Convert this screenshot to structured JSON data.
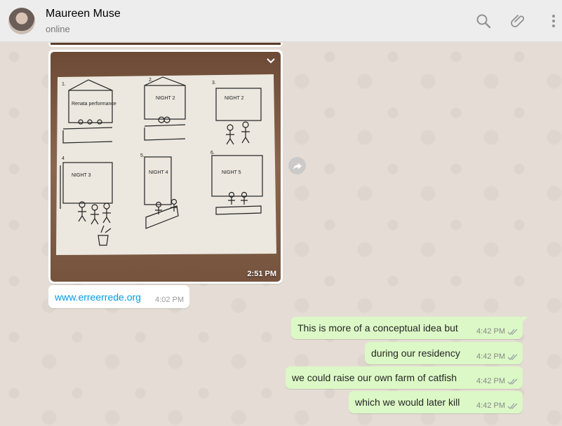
{
  "header": {
    "contact_name": "Maureen Muse",
    "status": "online",
    "icons": [
      "search-icon",
      "paperclip-icon",
      "menu-icon"
    ]
  },
  "messages": {
    "image": {
      "time": "2:51 PM"
    },
    "link": {
      "text": "www.erreerrede.org",
      "time": "4:02 PM"
    },
    "outgoing": [
      {
        "text": "This is more of a conceptual idea but",
        "time": "4:42 PM"
      },
      {
        "text": "during our residency",
        "time": "4:42 PM"
      },
      {
        "text": "we could raise our own farm of catfish",
        "time": "4:42 PM"
      },
      {
        "text": "which we would later kill",
        "time": "4:42 PM"
      }
    ]
  },
  "sketch": {
    "panels": [
      "1.",
      "2.",
      "3.",
      "4",
      "5.",
      "6."
    ],
    "labels": [
      "Renata performance",
      "NIGHT 2",
      "NIGHT 2",
      "NIGHT 3",
      "NIGHT 4",
      "NIGHT 5"
    ]
  },
  "colors": {
    "outgoing_bubble": "#dcf8c6",
    "link": "#039be5",
    "chat_bg": "#e5ddd5"
  }
}
